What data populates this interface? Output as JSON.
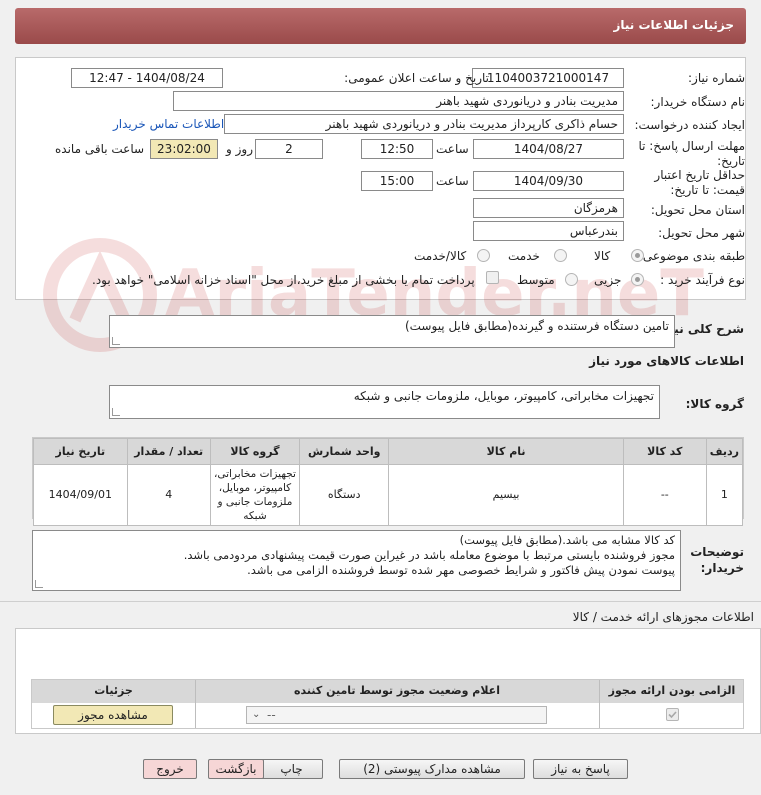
{
  "header": {
    "title": "جزئیات اطلاعات نیاز"
  },
  "watermark": {
    "text": "AriaTender.neT"
  },
  "form": {
    "need_number_label": "شماره نیاز:",
    "need_number": "1104003721000147",
    "announce_label": "تاریخ و ساعت اعلان عمومی:",
    "announce_value": "1404/08/24 - 12:47",
    "buyer_org_label": "نام دستگاه خریدار:",
    "buyer_org": "مدیریت بنادر و دریانوردی شهید باهنر",
    "requester_label": "ایجاد کننده درخواست:",
    "requester": "حسام  ذاکری کارپرداز مدیریت بنادر و دریانوردی شهید باهنر",
    "contact_link": "اطلاعات تماس خریدار",
    "deadline_label_1": "مهلت ارسال پاسخ: تا",
    "deadline_label_2": "تاریخ:",
    "deadline_date": "1404/08/27",
    "time_label": "ساعت",
    "deadline_time": "12:50",
    "days_value": "2",
    "days_label": "روز و",
    "remaining_time": "23:02:00",
    "remaining_label": "ساعت باقی مانده",
    "validity_label_1": "حداقل تاریخ اعتبار",
    "validity_label_2": "قیمت: تا تاریخ:",
    "validity_date": "1404/09/30",
    "validity_time": "15:00",
    "province_label": "استان محل تحویل:",
    "province": "هرمزگان",
    "city_label": "شهر محل تحویل:",
    "city": "بندرعباس",
    "category_label": "طبقه بندی موضوعی:",
    "category_options": [
      "کالا",
      "خدمت",
      "کالا/خدمت"
    ],
    "process_label": "نوع فرآیند خرید :",
    "process_options": [
      "جزیی",
      "متوسط"
    ],
    "payment_note": "پرداخت تمام یا بخشی از مبلغ خرید،از محل \"اسناد خزانه اسلامی\" خواهد بود."
  },
  "summary": {
    "label": "شرح کلی نیاز:",
    "value": "تامین دستگاه فرستنده و گیرنده(مطابق فایل پیوست)"
  },
  "goods_section": {
    "title": "اطلاعات کالاهای مورد نیاز",
    "group_label": "گروه کالا:",
    "group_value": "تجهیزات مخابراتی، کامپیوتر، موبایل، ملزومات جانبی و شبکه"
  },
  "items_table": {
    "headers": [
      "ردیف",
      "کد کالا",
      "نام کالا",
      "واحد شمارش",
      "گروه کالا",
      "تعداد / مقدار",
      "تاریخ نیاز"
    ],
    "rows": [
      {
        "row": "1",
        "code": "--",
        "name": "بیسیم",
        "unit": "دستگاه",
        "group": "تجهیزات مخابراتی، کامپیوتر، موبایل، ملزومات جانبی و شبکه",
        "qty": "4",
        "date": "1404/09/01"
      }
    ]
  },
  "buyer_notes": {
    "label_1": "توضیحات",
    "label_2": "خریدار:",
    "lines": [
      "کد کالا مشابه می باشد.(مطابق فایل پیوست)",
      "مجوز فروشنده بایستی مرتبط با موضوع معامله باشد در غیراین صورت قیمت پیشنهادی مردودمی باشد.",
      "پیوست نمودن پیش فاکتور و شرایط خصوصی مهر شده توسط فروشنده الزامی می باشد."
    ]
  },
  "permits": {
    "title": "اطلاعات مجوزهای ارائه خدمت / کالا",
    "headers": [
      "الزامی بودن ارائه مجوز",
      "اعلام وضعیت مجوز توسط تامین کننده",
      "جزئیات"
    ],
    "select_value": "--",
    "view_button": "مشاهده مجوز"
  },
  "footer": {
    "reply": "پاسخ به نیاز",
    "docs": "مشاهده مدارک پیوستی (2)",
    "print": "چاپ",
    "back": "بازگشت",
    "exit": "خروج"
  }
}
